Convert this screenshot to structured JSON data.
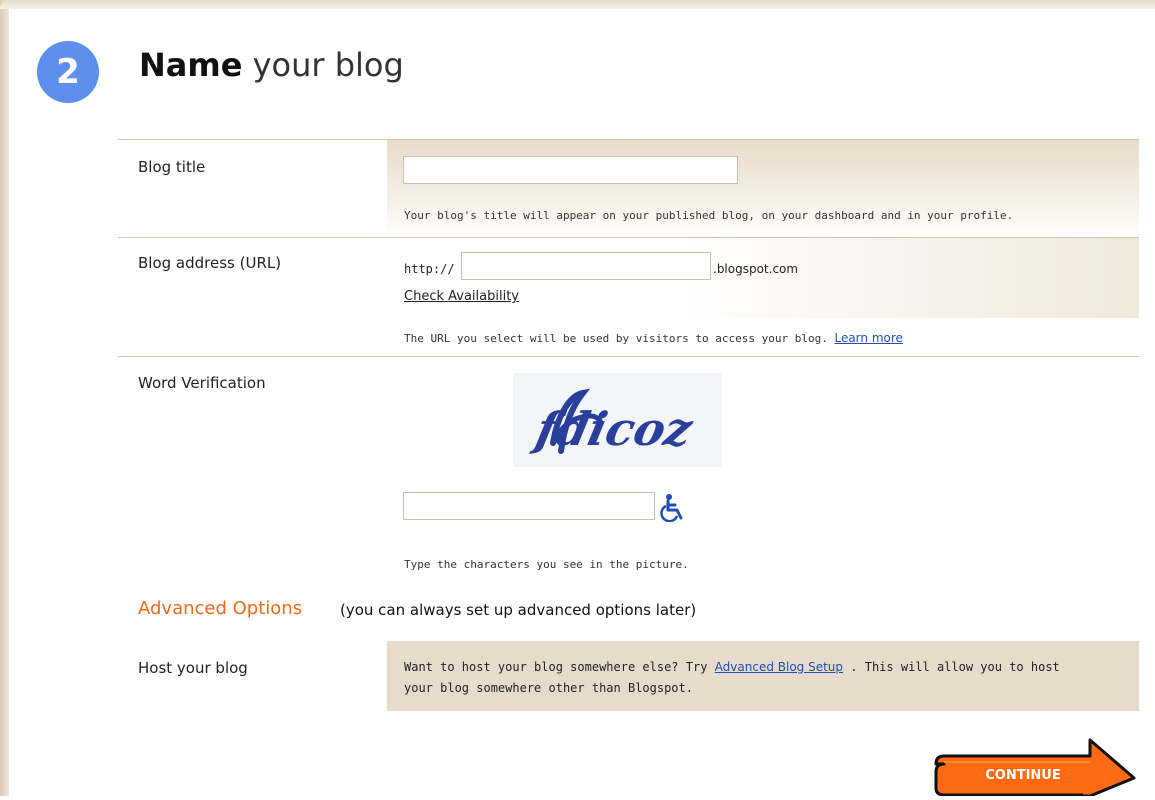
{
  "header": {
    "step_number": "2",
    "title_strong": "Name",
    "title_rest": "your blog"
  },
  "blog_title": {
    "label": "Blog title",
    "value": "",
    "help": "Your blog's title will appear on your published blog, on your dashboard and in your profile."
  },
  "blog_address": {
    "label": "Blog address (URL)",
    "prefix": "http://",
    "value": "",
    "suffix": ".blogspot.com",
    "check_link": "Check Availability",
    "help": "The URL you select will be used by visitors to access your blog.",
    "learn_more": "Learn more"
  },
  "word_verification": {
    "label": "Word Verification",
    "captcha_text": "fdicoz",
    "value": "",
    "accessibility_icon": "wheelchair-icon",
    "help": "Type the characters you see in the picture."
  },
  "advanced": {
    "title": "Advanced Options",
    "note": "(you can always set up advanced options later)"
  },
  "host": {
    "label": "Host your blog",
    "text_before": "Want to host your blog somewhere else? Try",
    "link": "Advanced Blog Setup",
    "text_after": ". This will allow you to host",
    "text_line2": "your blog somewhere other than Blogspot."
  },
  "continue_button": {
    "label": "CONTINUE"
  },
  "colors": {
    "step_circle": "#5e8fec",
    "accent_orange": "#ee6a1a",
    "link_blue": "#1f4fb4",
    "panel_beige": "#e7dccb"
  }
}
